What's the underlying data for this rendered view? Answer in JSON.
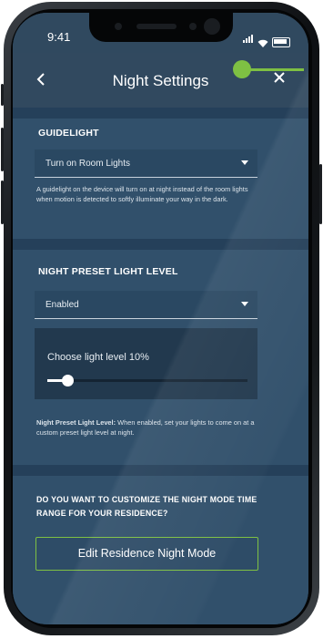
{
  "status_bar": {
    "time": "9:41"
  },
  "header": {
    "title": "Night Settings",
    "back_icon": "chevron-left-icon",
    "close_icon": "close-icon"
  },
  "guidelight": {
    "title": "GUIDELIGHT",
    "select_value": "Turn on Room Lights",
    "description": "A guidelight on the device will turn on at night instead of the room lights when motion is detected to softly illuminate your way in the dark."
  },
  "night_preset": {
    "title": "NIGHT PRESET LIGHT LEVEL",
    "select_value": "Enabled",
    "slider_label": "Choose light level 10%",
    "slider_value": 0.1,
    "note_bold": "Night Preset Light Level:",
    "note_text": "When enabled, set your lights to come on at a custom preset light level at night."
  },
  "night_mode": {
    "question": "DO YOU WANT TO CUSTOMIZE THE NIGHT MODE TIME RANGE FOR YOUR RESIDENCE?",
    "button_label": "Edit Residence Night Mode"
  },
  "colors": {
    "accent": "#7ec043",
    "background": "#2e4a64"
  }
}
